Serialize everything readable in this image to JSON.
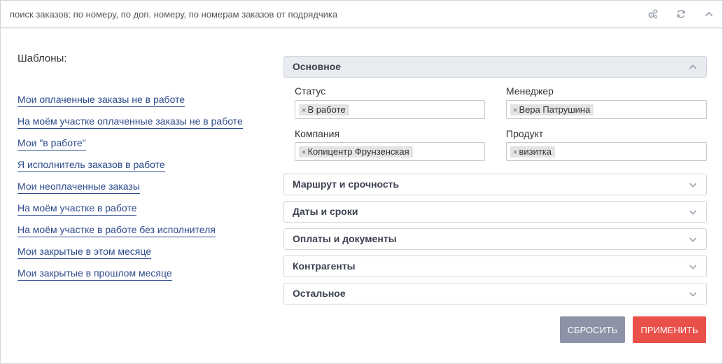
{
  "search": {
    "placeholder": "поиск заказов: по номеру, по доп. номеру, по номерам заказов от подрядчика"
  },
  "toolbar": {
    "icons": [
      "settings-gears-icon",
      "refresh-icon",
      "chevron-up-icon"
    ],
    "icon_color": "#9aa3ad"
  },
  "templates": {
    "title": "Шаблоны:",
    "links": [
      "Мои оплаченные заказы не в работе",
      "На моём участке оплаченные заказы не в работе",
      "Мои \"в работе\"",
      "Я исполнитель заказов в работе",
      "Мои неоплаченные заказы",
      "На моём участке в работе",
      "На моём участке в работе без исполнителя",
      "Мои закрытые в этом месяце",
      "Мои закрытые в прошлом месяце"
    ]
  },
  "filters": {
    "main": {
      "title": "Основное",
      "status": {
        "label": "Статус",
        "tag": "В работе"
      },
      "manager": {
        "label": "Менеджер",
        "tag": "Вера Патрушина"
      },
      "company": {
        "label": "Компания",
        "tag": "Копицентр Фрунзенская"
      },
      "product": {
        "label": "Продукт",
        "tag": "визитка"
      }
    },
    "sections": [
      "Маршрут и срочность",
      "Даты и сроки",
      "Оплаты и документы",
      "Контрагенты",
      "Остальное"
    ]
  },
  "actions": {
    "reset": "СБРОСИТЬ",
    "apply": "ПРИМЕНИТЬ"
  },
  "colors": {
    "link": "#2c4a8c",
    "reset_button": "#8d93a6",
    "apply_button": "#e9504a",
    "open_section_bg": "#e8ebef"
  }
}
